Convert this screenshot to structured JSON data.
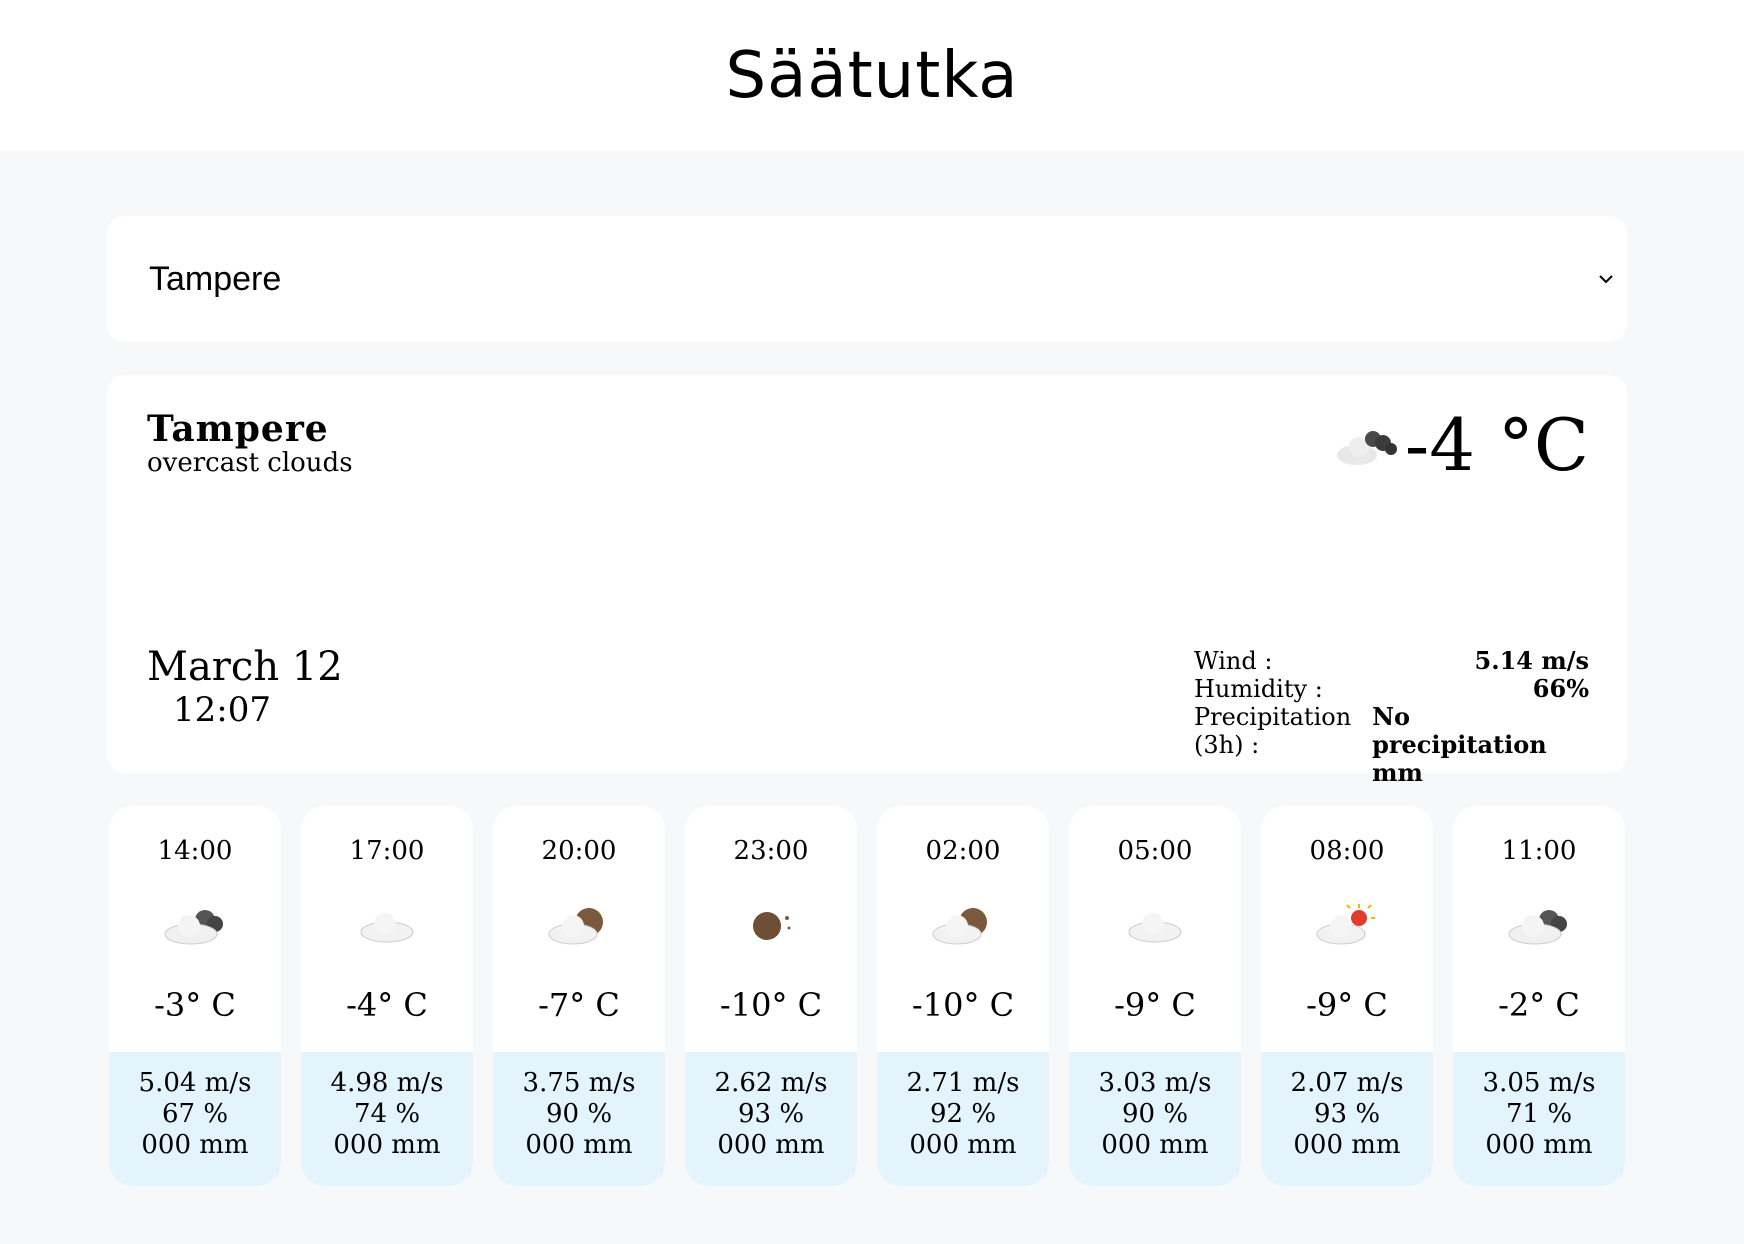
{
  "header": {
    "title": "Säätutka"
  },
  "city_select": {
    "value": "Tampere"
  },
  "current": {
    "city": "Tampere",
    "description": "overcast clouds",
    "temperature": "-4 °C",
    "icon": "overcast-clouds-icon",
    "date": "March 12",
    "time": "12:07",
    "details": [
      {
        "label": "Wind :",
        "value": "5.14 m/s"
      },
      {
        "label": "Humidity :",
        "value": "66%"
      },
      {
        "label": "Precipitation (3h) :",
        "value": "No precipitation mm"
      }
    ]
  },
  "forecast": [
    {
      "time": "14:00",
      "icon": "broken-clouds-icon",
      "temp": "-3° C",
      "wind": "5.04 m/s",
      "humidity": "67 %",
      "precip": "000 mm"
    },
    {
      "time": "17:00",
      "icon": "cloud-icon",
      "temp": "-4° C",
      "wind": "4.98 m/s",
      "humidity": "74 %",
      "precip": "000 mm"
    },
    {
      "time": "20:00",
      "icon": "cloud-moon-icon",
      "temp": "-7° C",
      "wind": "3.75 m/s",
      "humidity": "90 %",
      "precip": "000 mm"
    },
    {
      "time": "23:00",
      "icon": "moon-icon",
      "temp": "-10° C",
      "wind": "2.62 m/s",
      "humidity": "93 %",
      "precip": "000 mm"
    },
    {
      "time": "02:00",
      "icon": "cloud-moon-icon",
      "temp": "-10° C",
      "wind": "2.71 m/s",
      "humidity": "92 %",
      "precip": "000 mm"
    },
    {
      "time": "05:00",
      "icon": "cloud-icon",
      "temp": "-9° C",
      "wind": "3.03 m/s",
      "humidity": "90 %",
      "precip": "000 mm"
    },
    {
      "time": "08:00",
      "icon": "cloud-sun-icon",
      "temp": "-9° C",
      "wind": "2.07 m/s",
      "humidity": "93 %",
      "precip": "000 mm"
    },
    {
      "time": "11:00",
      "icon": "broken-clouds-icon",
      "temp": "-2° C",
      "wind": "3.05 m/s",
      "humidity": "71 %",
      "precip": "000 mm"
    }
  ]
}
